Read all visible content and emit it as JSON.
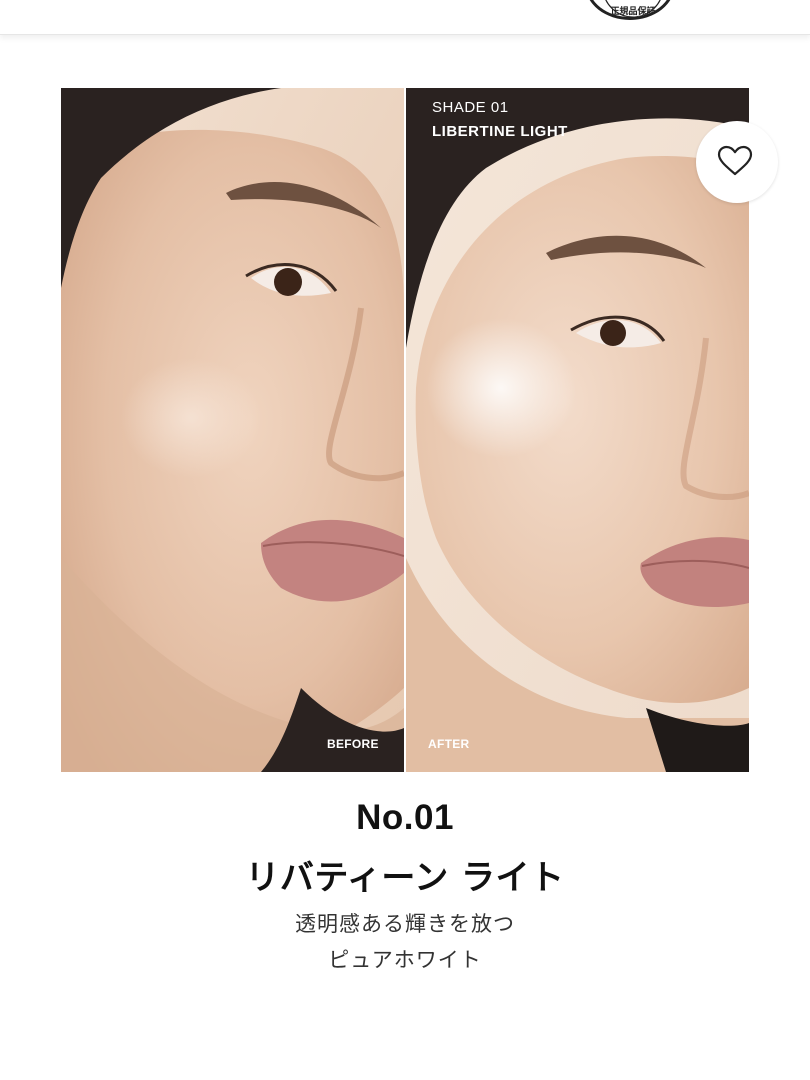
{
  "header": {
    "badge_text": "正規品保証"
  },
  "comparison": {
    "shade_number": "SHADE 01",
    "shade_name": "LIBERTINE LIGHT",
    "before_label": "BEFORE",
    "after_label": "AFTER"
  },
  "product": {
    "number": "No.01",
    "name_jp": "リバティーン ライト",
    "tagline_line1": "透明感ある輝きを放つ",
    "tagline_line2": "ピュアホワイト"
  },
  "icons": {
    "favorite": "heart-outline-icon",
    "badge": "authentic-seal-icon"
  },
  "colors": {
    "skin": "#e9cbb4",
    "hair": "#2a2220",
    "text": "#111111",
    "background": "#ffffff"
  }
}
